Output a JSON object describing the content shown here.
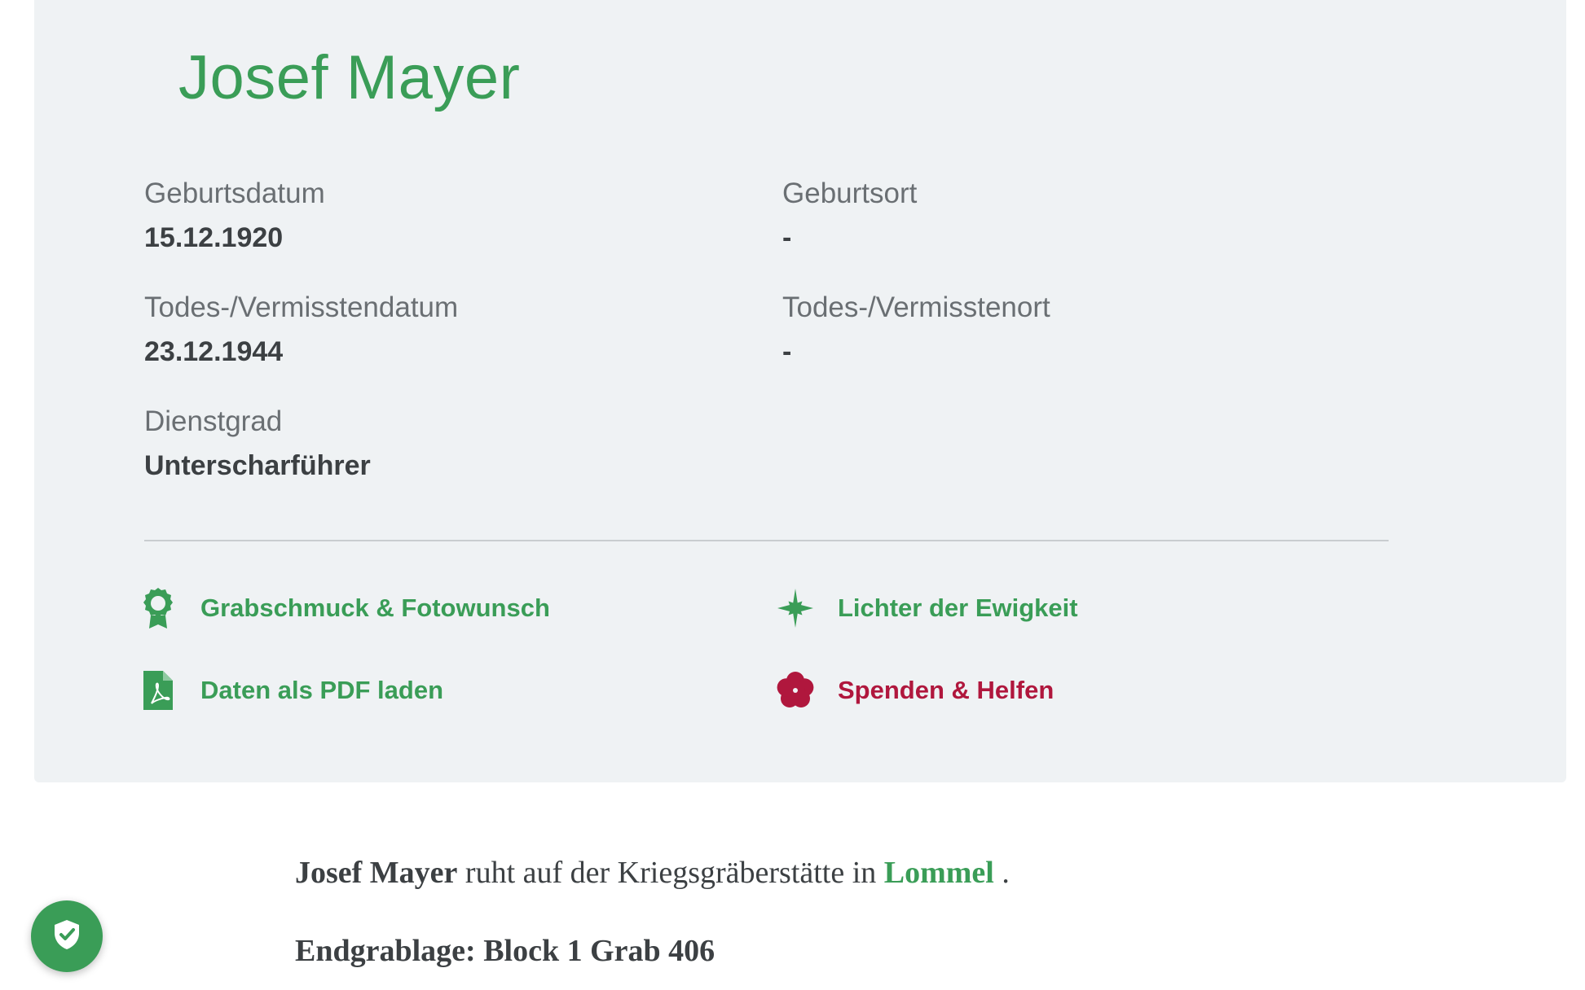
{
  "person": {
    "name": "Josef Mayer"
  },
  "fields": {
    "birth_date": {
      "label": "Geburtsdatum",
      "value": "15.12.1920"
    },
    "birth_place": {
      "label": "Geburtsort",
      "value": "-"
    },
    "death_date": {
      "label": "Todes-/Vermisstendatum",
      "value": "23.12.1944"
    },
    "death_place": {
      "label": "Todes-/Vermisstenort",
      "value": "-"
    },
    "rank": {
      "label": "Dienstgrad",
      "value": "Unterscharführer"
    }
  },
  "actions": {
    "grabschmuck": {
      "label": "Grabschmuck & Fotowunsch",
      "icon": "rosette-icon"
    },
    "lichter": {
      "label": "Lichter der Ewigkeit",
      "icon": "star-sparkle-icon"
    },
    "pdf": {
      "label": "Daten als PDF laden",
      "icon": "pdf-file-icon"
    },
    "spenden": {
      "label": "Spenden & Helfen",
      "icon": "flower-icon"
    }
  },
  "resting": {
    "name": "Josef Mayer",
    "text": " ruht auf der Kriegsgräberstätte in ",
    "place": "Lommel",
    "suffix": " ."
  },
  "final_grave": "Endgrablage: Block 1 Grab 406",
  "colors": {
    "accent_green": "#3a9d57",
    "accent_red": "#b0173d",
    "card_bg": "#eff2f4"
  },
  "privacy_button": {
    "icon": "shield-check-icon"
  }
}
